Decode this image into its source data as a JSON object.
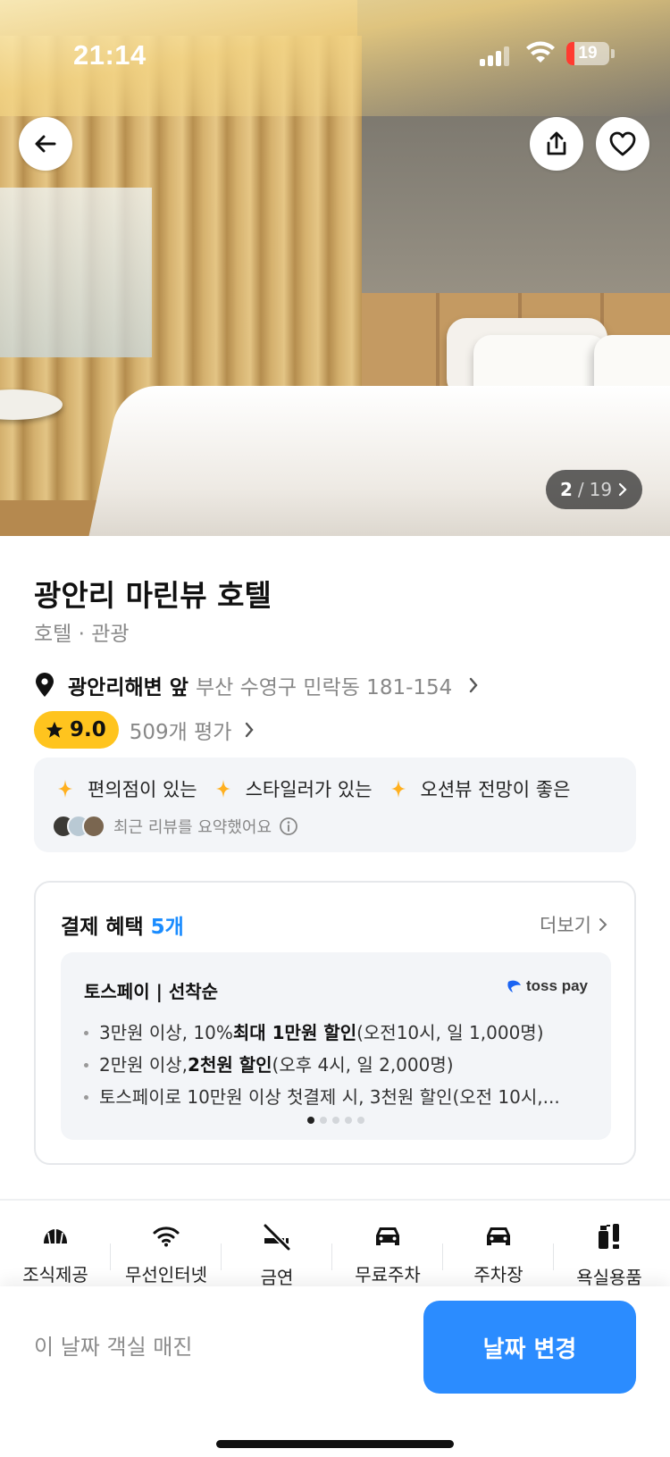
{
  "status_bar": {
    "time": "21:14",
    "battery": "19",
    "battery_level": 0.19
  },
  "gallery": {
    "current": "2",
    "separator": "/",
    "total": "19"
  },
  "hotel": {
    "name": "광안리 마린뷰 호텔",
    "category": "호텔 · 관광",
    "landmark": "광안리해변 앞",
    "address": "부산 수영구 민락동 181-154",
    "rating": "9.0",
    "review_count": "509개 평가"
  },
  "review_summary": {
    "tags": [
      "편의점이 있는",
      "스타일러가 있는",
      "오션뷰 전망이 좋은"
    ],
    "note": "최근 리뷰를 요약했어요"
  },
  "benefits": {
    "title": "결제 혜택",
    "count": "5개",
    "more": "더보기",
    "card": {
      "title": "토스페이 | 선착순",
      "logo_text": "toss pay",
      "items": [
        {
          "pre": "3만원 이상, 10% ",
          "bold": "최대 1만원 할인",
          "post": "(오전10시, 일 1,000명)"
        },
        {
          "pre": "2만원 이상, ",
          "bold": "2천원 할인",
          "post": " (오후 4시, 일 2,000명)"
        },
        {
          "pre": "토스페이로 10만원 이상 첫결제 시, 3천원 할인(오전 10시,...",
          "bold": "",
          "post": ""
        }
      ],
      "page_count": 5,
      "active_page": 0
    }
  },
  "amenities": [
    {
      "label": "조식제공",
      "icon": "breakfast-icon"
    },
    {
      "label": "무선인터넷",
      "icon": "wifi-icon"
    },
    {
      "label": "금연",
      "icon": "no-smoking-icon"
    },
    {
      "label": "무료주차",
      "icon": "car-icon"
    },
    {
      "label": "주차장",
      "icon": "car-icon"
    },
    {
      "label": "욕실용품",
      "icon": "toiletries-icon"
    }
  ],
  "bottom_bar": {
    "message": "이 날짜 객실 매진",
    "button": "날짜 변경"
  },
  "colors": {
    "accent": "#2b8cff",
    "rating": "#ffc41e",
    "sparkle": "#ffb01f",
    "count_blue": "#1a8cff"
  }
}
